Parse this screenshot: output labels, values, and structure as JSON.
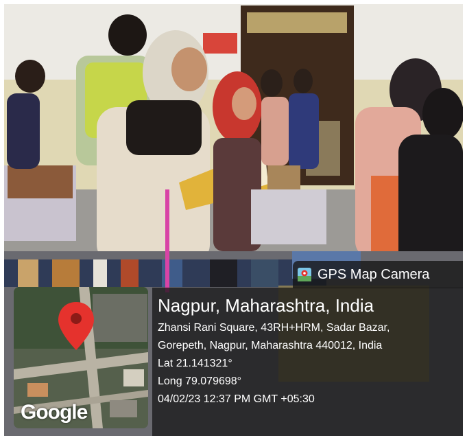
{
  "overlay": {
    "camera_label": "GPS Map Camera",
    "city": "Nagpur, Maharashtra, India",
    "address_line1": "Zhansi Rani Square, 43RH+HRM, Sadar Bazar,",
    "address_line2": "Gorepeth, Nagpur, Maharashtra 440012, India",
    "latitude": "Lat 21.141321°",
    "longitude": "Long 79.079698°",
    "datetime": "04/02/23 12:37 PM GMT +05:30",
    "map_brand": "Google",
    "icon": "map-thumbnail-icon"
  },
  "colors": {
    "pin": "#e5322d",
    "panel": "#141414"
  }
}
